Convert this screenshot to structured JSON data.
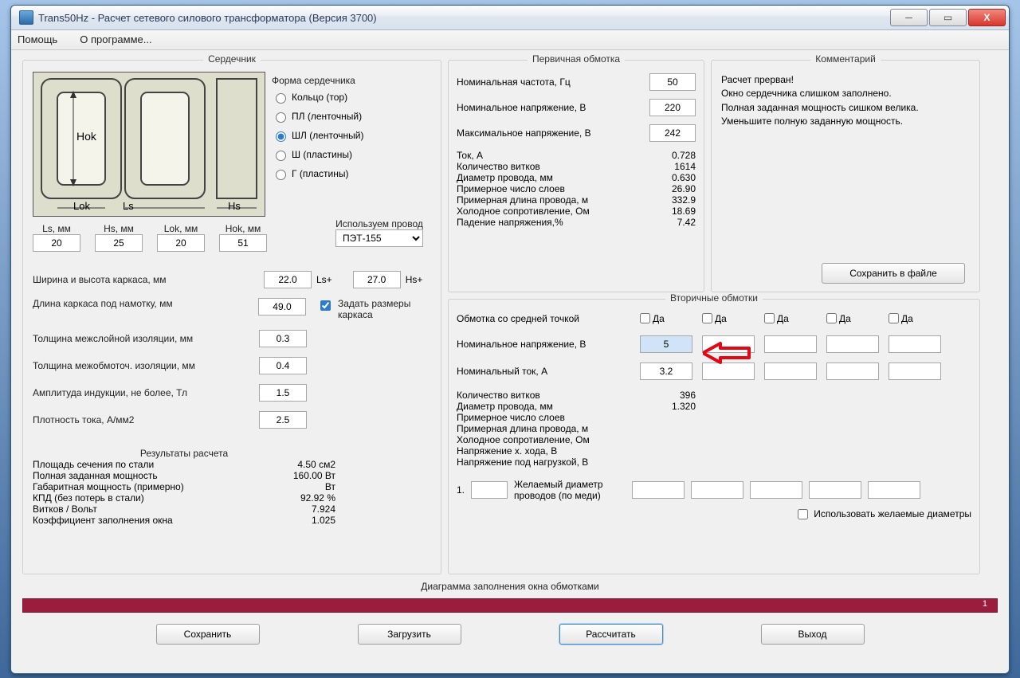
{
  "title": "Trans50Hz - Расчет сетевого силового трансформатора (Версия 3700)",
  "menu": {
    "help": "Помощь",
    "about": "О программе..."
  },
  "core": {
    "legend": "Сердечник",
    "form_label": "Форма сердечника",
    "options": {
      "ring": "Кольцо (тор)",
      "pl": "ПЛ (ленточный)",
      "shl": "ШЛ (ленточный)",
      "sh": "Ш  (пластины)",
      "g": "Г (пластины)"
    },
    "diagram": {
      "hok": "Hok",
      "lok": "Lok",
      "ls": "Ls",
      "hs": "Hs"
    },
    "dims": {
      "ls_label": "Ls, мм",
      "hs_label": "Hs, мм",
      "lok_label": "Lok, мм",
      "hok_label": "Hok, мм",
      "ls": "20",
      "hs": "25",
      "lok": "20",
      "hok": "51"
    },
    "wire_label": "Используем провод",
    "wire_value": "ПЭТ-155",
    "frame_wh_label": "Ширина и высота каркаса, мм",
    "frame_w": "22.0",
    "frame_h": "27.0",
    "lsplus": "Ls+",
    "hsplus": "Hs+",
    "frame_len_label": "Длина каркаса под намотку, мм",
    "frame_len": "49.0",
    "manual_frame": "Задать размеры каркаса",
    "interlayer_label": "Толщина межслойной изоляции, мм",
    "interlayer": "0.3",
    "interwind_label": "Толщина межобмоточ. изоляции, мм",
    "interwind": "0.4",
    "bmax_label": "Амплитуда индукции, не более, Тл",
    "bmax": "1.5",
    "jdens_label": "Плотность тока, А/мм2",
    "jdens": "2.5",
    "results_legend": "Результаты расчета",
    "res": {
      "steel_area_l": "Площадь сечения по стали",
      "steel_area_v": "4.50 см2",
      "full_power_l": "Полная заданная мощность",
      "full_power_v": "160.00 Вт",
      "gabar_power_l": "Габаритная мощность (примерно)",
      "gabar_power_v": "Вт",
      "kpd_l": "КПД (без потерь в стали)",
      "kpd_v": "92.92 %",
      "tpv_l": "Витков / Вольт",
      "tpv_v": "7.924",
      "fill_l": "Коэффициент заполнения окна",
      "fill_v": "1.025"
    }
  },
  "primary": {
    "legend": "Первичная обмотка",
    "freq_l": "Номинальная частота, Гц",
    "freq": "50",
    "vnom_l": "Номинальное напряжение, В",
    "vnom": "220",
    "vmax_l": "Максимальное напряжение, В",
    "vmax": "242",
    "current_l": "Ток, А",
    "current_v": "0.728",
    "turns_l": "Количество витков",
    "turns_v": "1614",
    "dwire_l": "Диаметр провода, мм",
    "dwire_v": "0.630",
    "layers_l": "Примерное число слоев",
    "layers_v": "26.90",
    "wlen_l": "Примерная длина провода, м",
    "wlen_v": "332.9",
    "rcold_l": "Холодное сопротивление, Ом",
    "rcold_v": "18.69",
    "vdrop_l": "Падение напряжения,%",
    "vdrop_v": "7.42"
  },
  "comment": {
    "legend": "Комментарий",
    "lines": [
      "Расчет прерван!",
      "Окно сердечника слишком заполнено.",
      "Полная заданная мощность сишком велика.",
      "Уменьшите полную заданную мощность."
    ],
    "save_btn": "Сохранить в файле"
  },
  "secondary": {
    "legend": "Вторичные обмотки",
    "mid_l": "Обмотка со средней точкой",
    "da": "Да",
    "vnom_l": "Номинальное напряжение, В",
    "vnom": "5",
    "inom_l": "Номинальный ток, А",
    "inom": "3.2",
    "turns_l": "Количество витков",
    "turns_v": "396",
    "dwire_l": "Диаметр провода, мм",
    "dwire_v": "1.320",
    "layers_l": "Примерное число слоев",
    "wlen_l": "Примерная длина провода, м",
    "rcold_l": "Холодное сопротивление, Ом",
    "vopen_l": "Напряжение х. хода, В",
    "vload_l": "Напряжение под нагрузкой, В",
    "wish_idx": "1.",
    "wish_l1": "Желаемый диаметр",
    "wish_l2": "проводов  (по меди)",
    "use_wish": "Использовать желаемые диаметры"
  },
  "diagram_label": "Диаграмма заполнения окна обмотками",
  "diagram_num": "1",
  "btns": {
    "save": "Сохранить",
    "load": "Загрузить",
    "calc": "Рассчитать",
    "exit": "Выход"
  }
}
